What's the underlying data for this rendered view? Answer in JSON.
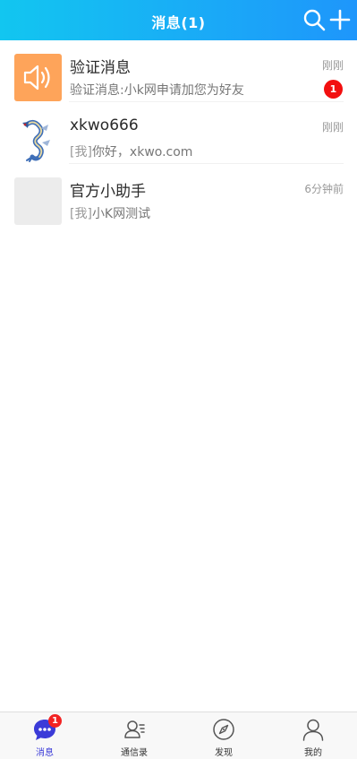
{
  "header": {
    "title": "消息(1)",
    "search_icon": "search-icon",
    "add_icon": "plus-icon"
  },
  "colors": {
    "header_start": "#12c6f0",
    "header_end": "#1e96fb",
    "badge": "#f20f0f",
    "active_tab": "#3b3bd8",
    "avatar_orange": "#fea45a"
  },
  "conversations": [
    {
      "name": "验证消息",
      "time": "刚刚",
      "preview": "验证消息:小k网申请加您为好友",
      "prefix": "",
      "unread": "1",
      "avatar": "speaker-icon"
    },
    {
      "name": "xkwo666",
      "time": "刚刚",
      "preview": "你好，xkwo.com",
      "prefix": "[我]",
      "unread": "",
      "avatar": "dragon-avatar"
    },
    {
      "name": "官方小助手",
      "time": "6分钟前",
      "preview": "小K网测试",
      "prefix": "[我]",
      "unread": "",
      "avatar": "blank-avatar"
    }
  ],
  "tabbar": {
    "items": [
      {
        "label": "消息",
        "icon": "chat-bubble-icon",
        "active": true,
        "badge": "1"
      },
      {
        "label": "通信录",
        "icon": "contacts-icon",
        "active": false
      },
      {
        "label": "发现",
        "icon": "compass-icon",
        "active": false
      },
      {
        "label": "我的",
        "icon": "user-icon",
        "active": false
      }
    ]
  }
}
